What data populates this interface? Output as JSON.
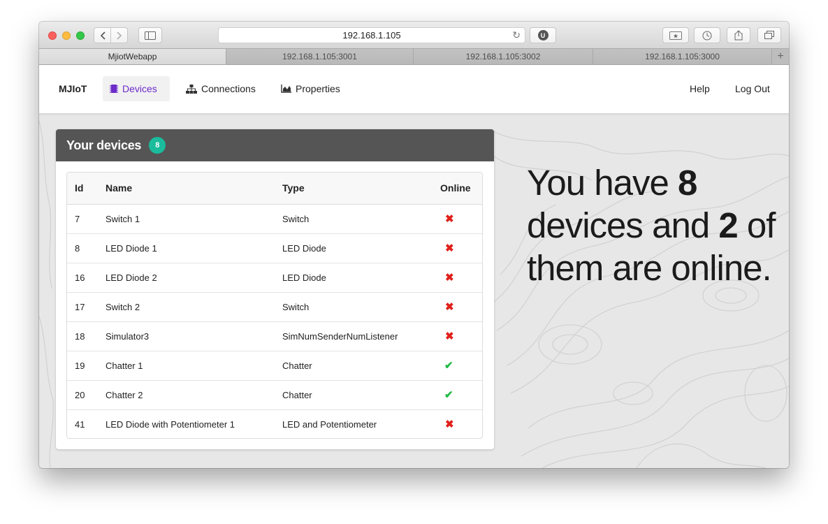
{
  "browser": {
    "url": "192.168.1.105",
    "tabs": [
      {
        "label": "MjiotWebapp",
        "active": true
      },
      {
        "label": "192.168.1.105:3001",
        "active": false
      },
      {
        "label": "192.168.1.105:3002",
        "active": false
      },
      {
        "label": "192.168.1.105:3000",
        "active": false
      }
    ],
    "extension_badge": "U"
  },
  "navbar": {
    "brand": "MJIoT",
    "items": [
      {
        "label": "Devices",
        "icon": "chip-icon",
        "active": true
      },
      {
        "label": "Connections",
        "icon": "sitemap-icon",
        "active": false
      },
      {
        "label": "Properties",
        "icon": "area-chart-icon",
        "active": false
      }
    ],
    "help": "Help",
    "logout": "Log Out",
    "accent_color": "#6d2bc9"
  },
  "devices_card": {
    "title": "Your devices",
    "count": "8",
    "badge_color": "#1abc9c",
    "columns": [
      "Id",
      "Name",
      "Type",
      "Online"
    ],
    "rows": [
      {
        "id": "7",
        "name": "Switch 1",
        "type": "Switch",
        "online": false
      },
      {
        "id": "8",
        "name": "LED Diode 1",
        "type": "LED Diode",
        "online": false
      },
      {
        "id": "16",
        "name": "LED Diode 2",
        "type": "LED Diode",
        "online": false
      },
      {
        "id": "17",
        "name": "Switch 2",
        "type": "Switch",
        "online": false
      },
      {
        "id": "18",
        "name": "Simulator3",
        "type": "SimNumSenderNumListener",
        "online": false
      },
      {
        "id": "19",
        "name": "Chatter 1",
        "type": "Chatter",
        "online": true
      },
      {
        "id": "20",
        "name": "Chatter 2",
        "type": "Chatter",
        "online": true
      },
      {
        "id": "41",
        "name": "LED Diode with Potentiometer 1",
        "type": "LED and Potentiometer",
        "online": false
      }
    ],
    "offline_color": "#e0201b",
    "online_color": "#21ba45"
  },
  "summary": {
    "part1": "You have ",
    "total": "8",
    "part2": " devices and ",
    "online": "2",
    "part3": " of them are online."
  }
}
